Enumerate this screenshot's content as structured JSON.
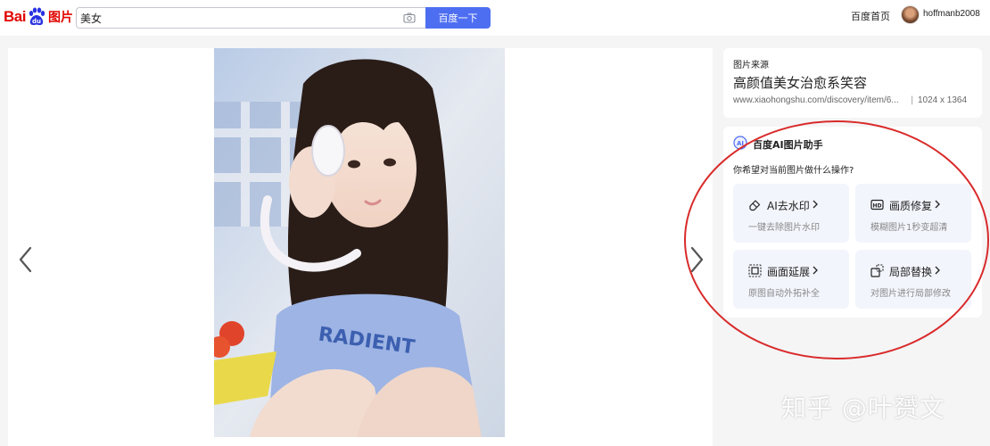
{
  "header": {
    "logo_text_bai": "Bai",
    "logo_text_du": "du",
    "logo_text_product": "图片",
    "search_value": "美女",
    "search_button": "百度一下",
    "home_link": "百度首页",
    "username": "hoffmanb2008",
    "icons": {
      "camera": "camera-icon",
      "logo": "baidu-paw-logo"
    }
  },
  "viewer": {
    "prev_icon": "chevron-left-icon",
    "next_icon": "chevron-right-icon",
    "photo_text": "RADIENT"
  },
  "source": {
    "label": "图片来源",
    "title": "高颜值美女治愈系笑容",
    "url": "www.xiaohongshu.com/discovery/item/6...",
    "separator": "|",
    "size": "1024 x 1364"
  },
  "ai_assistant": {
    "title": "百度AI图片助手",
    "question": "你希望对当前图片做什么操作?",
    "tools": [
      {
        "name": "AI去水印",
        "desc": "一键去除图片水印",
        "icon": "eraser-icon"
      },
      {
        "name": "画质修复",
        "desc": "模糊图片1秒变超清",
        "icon": "hd-icon"
      },
      {
        "name": "画面延展",
        "desc": "原图自动外拓补全",
        "icon": "expand-icon"
      },
      {
        "name": "局部替换",
        "desc": "对图片进行局部修改",
        "icon": "replace-icon"
      }
    ]
  },
  "watermark": "知乎 @叶赟文",
  "colors": {
    "brand_red": "#e10601",
    "search_blue": "#4e6ef2",
    "annotation_red": "#d92b2b",
    "tool_bg": "#f3f5fc"
  }
}
